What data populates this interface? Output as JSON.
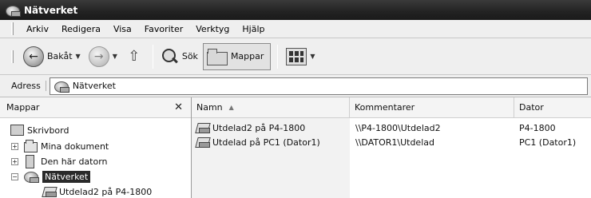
{
  "window": {
    "title": "Nätverket"
  },
  "menu": [
    "Arkiv",
    "Redigera",
    "Visa",
    "Favoriter",
    "Verktyg",
    "Hjälp"
  ],
  "toolbar": {
    "back_label": "Bakåt",
    "search_label": "Sök",
    "folders_label": "Mappar",
    "icons": [
      "back-arrow-icon",
      "forward-arrow-icon",
      "folder-up-icon",
      "search-icon",
      "folders-icon",
      "views-icon"
    ]
  },
  "address": {
    "label": "Adress",
    "value": "Nätverket",
    "icon": "network-places-icon"
  },
  "folders_pane": {
    "title": "Mappar",
    "tree": [
      {
        "label": "Skrivbord",
        "icon": "desktop-icon",
        "expander": ""
      },
      {
        "label": "Mina dokument",
        "icon": "my-documents-icon",
        "expander": "+"
      },
      {
        "label": "Den här datorn",
        "icon": "my-computer-icon",
        "expander": "+"
      },
      {
        "label": "Nätverket",
        "icon": "network-places-icon",
        "expander": "−",
        "selected": true
      },
      {
        "label": "Utdelad2 på P4-1800",
        "icon": "network-share-icon",
        "expander": ""
      }
    ]
  },
  "list": {
    "columns": [
      "Namn",
      "Kommentarer",
      "Dator"
    ],
    "sorted_by": "Namn",
    "rows": [
      {
        "name": "Utdelad2 på P4-1800",
        "comment": "\\\\P4-1800\\Utdelad2",
        "computer": "P4-1800",
        "icon": "network-share-icon"
      },
      {
        "name": "Utdelad på PC1 (Dator1)",
        "comment": "\\\\DATOR1\\Utdelad",
        "computer": "PC1 (Dator1)",
        "icon": "network-share-icon"
      }
    ]
  }
}
